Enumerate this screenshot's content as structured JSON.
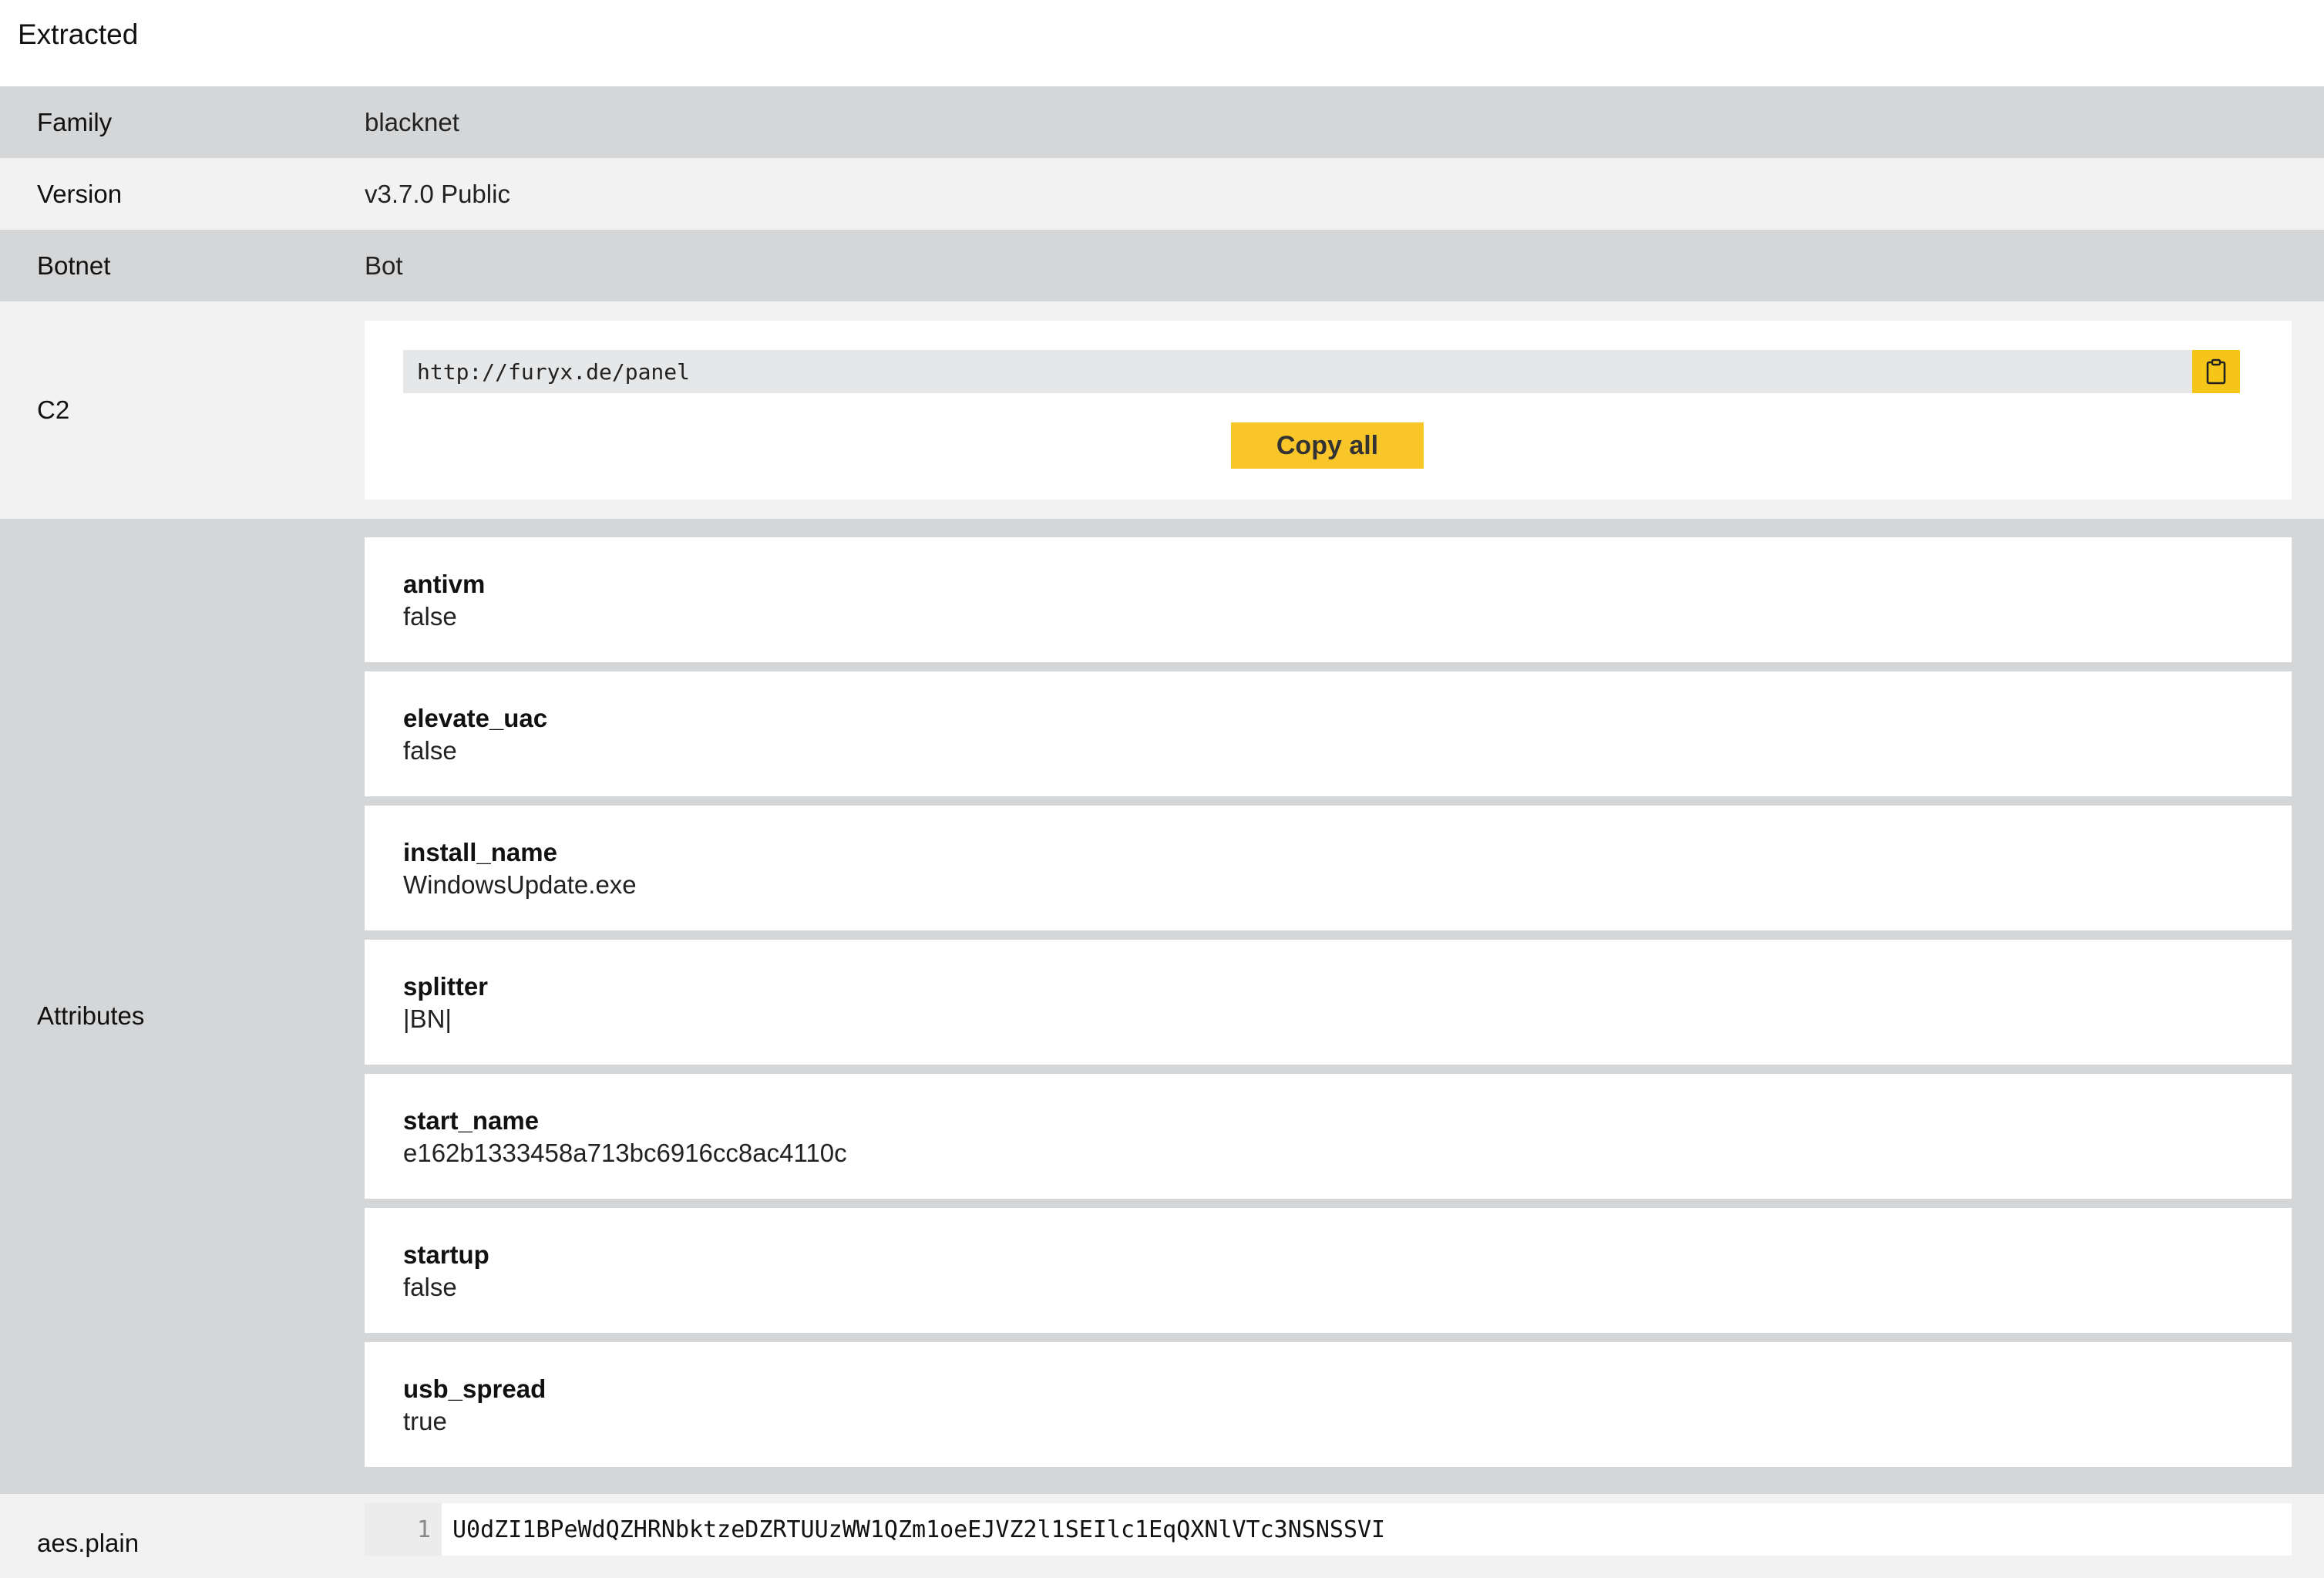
{
  "header": {
    "title": "Extracted"
  },
  "rows": {
    "family": {
      "label": "Family",
      "value": "blacknet"
    },
    "version": {
      "label": "Version",
      "value": "v3.7.0 Public"
    },
    "botnet": {
      "label": "Botnet",
      "value": "Bot"
    }
  },
  "c2": {
    "label": "C2",
    "entries": [
      "http://furyx.de/panel"
    ],
    "copy_icon": "clipboard-icon",
    "copy_all_label": "Copy all",
    "accent_color": "#f9c62a"
  },
  "attributes": {
    "label": "Attributes",
    "items": [
      {
        "key": "antivm",
        "value": "false"
      },
      {
        "key": "elevate_uac",
        "value": "false"
      },
      {
        "key": "install_name",
        "value": "WindowsUpdate.exe"
      },
      {
        "key": "splitter",
        "value": "|BN|"
      },
      {
        "key": "start_name",
        "value": "e162b1333458a713bc6916cc8ac4110c"
      },
      {
        "key": "startup",
        "value": "false"
      },
      {
        "key": "usb_spread",
        "value": "true"
      }
    ]
  },
  "aes": {
    "label": "aes.plain",
    "line_number": "1",
    "code": "U0dZI1BPeWdQZHRNbktzeDZRTUUzWW1QZm1oeEJVZ2l1SEIlc1EqQXNlVTc3NSNSSVI"
  }
}
